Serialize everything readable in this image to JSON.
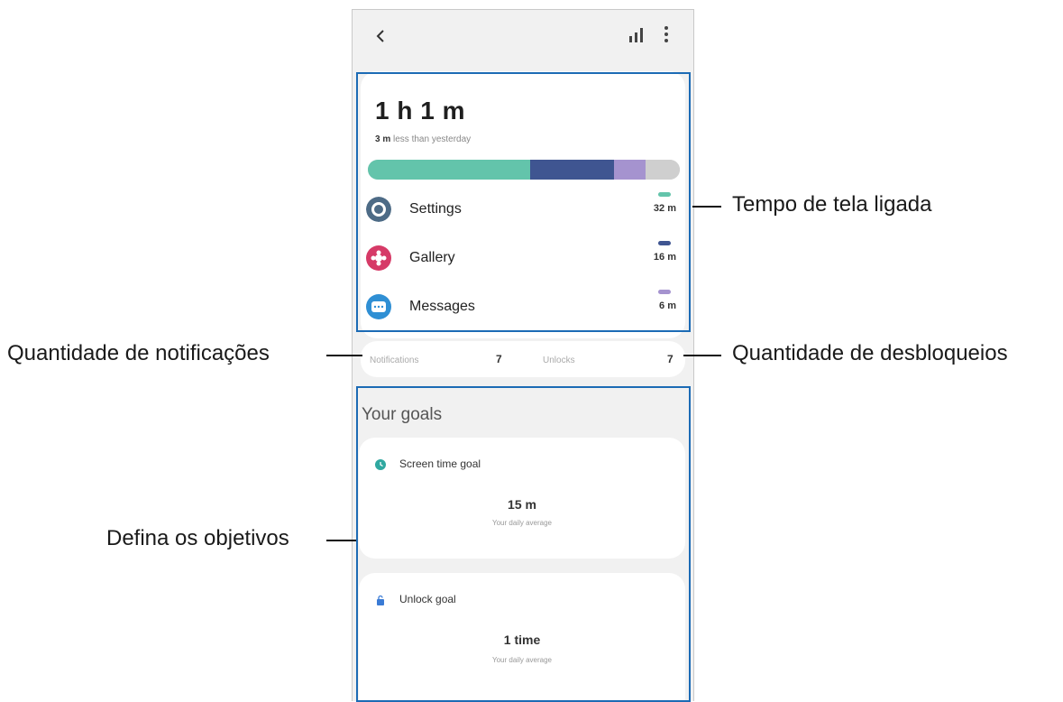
{
  "header": {
    "back_icon": "chevron-left-icon",
    "stats_icon": "bar-chart-icon",
    "more_icon": "more-vertical-icon"
  },
  "summary": {
    "total_time": "1 h 1 m",
    "delta_value": "3 m",
    "delta_text": "less than yesterday",
    "usage_bar": [
      {
        "app": "Settings",
        "fraction": 0.52,
        "color": "#63c4ab"
      },
      {
        "app": "Gallery",
        "fraction": 0.27,
        "color": "#3f5591"
      },
      {
        "app": "Messages",
        "fraction": 0.1,
        "color": "#a593cf"
      },
      {
        "app": "Other",
        "fraction": 0.11,
        "color": "#cfcfcf"
      }
    ]
  },
  "apps": [
    {
      "name": "Settings",
      "time": "32 m",
      "icon": "settings-icon",
      "icon_color": "#4d6b86",
      "pill_color": "#63c4ab"
    },
    {
      "name": "Gallery",
      "time": "16 m",
      "icon": "gallery-icon",
      "icon_color": "#d63a67",
      "pill_color": "#3f5591"
    },
    {
      "name": "Messages",
      "time": "6 m",
      "icon": "messages-icon",
      "icon_color": "#2f8fd4",
      "pill_color": "#a593cf"
    }
  ],
  "counts": {
    "notifications_label": "Notifications",
    "notifications_value": "7",
    "unlocks_label": "Unlocks",
    "unlocks_value": "7"
  },
  "goals": {
    "title": "Your goals",
    "screen_time": {
      "label": "Screen time goal",
      "value": "15 m",
      "sub": "Your daily average",
      "icon": "clock-icon"
    },
    "unlock": {
      "label": "Unlock goal",
      "value": "1 time",
      "sub": "Your daily average",
      "icon": "lock-icon"
    }
  },
  "callouts": {
    "screen_time": "Tempo de tela ligada",
    "notifications": "Quantidade de notificações",
    "unlocks": "Quantidade de desbloqueios",
    "goals": "Defina os objetivos"
  },
  "accent_color": "#1c6bb5"
}
